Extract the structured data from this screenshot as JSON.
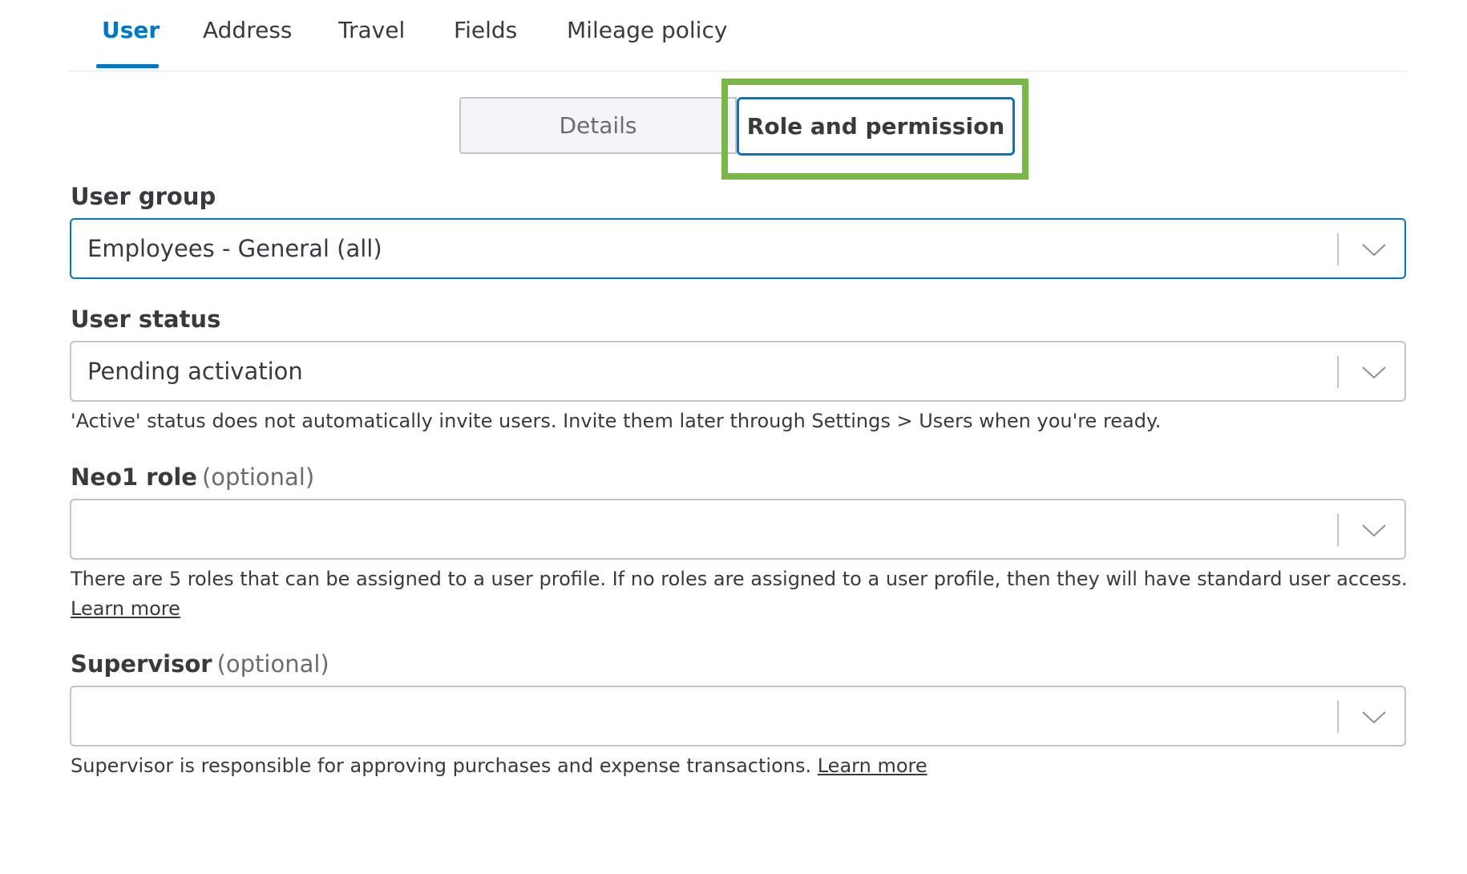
{
  "tabs": [
    {
      "label": "User",
      "active": true
    },
    {
      "label": "Address",
      "active": false
    },
    {
      "label": "Travel",
      "active": false
    },
    {
      "label": "Fields",
      "active": false
    },
    {
      "label": "Mileage policy",
      "active": false
    }
  ],
  "segments": {
    "details_label": "Details",
    "role_label": "Role and permission",
    "selected": "Role and permission"
  },
  "user_group": {
    "label": "User group",
    "value": "Employees - General (all)"
  },
  "user_status": {
    "label": "User status",
    "value": "Pending activation",
    "help": "'Active' status does not automatically invite users. Invite them later through Settings > Users when you're ready."
  },
  "neo1_role": {
    "label": "Neo1 role",
    "optional": "(optional)",
    "value": "",
    "help": "There are 5 roles that can be assigned to a user profile. If no roles are assigned to a user profile, then they will have standard user access.",
    "link": "Learn more"
  },
  "supervisor": {
    "label": "Supervisor",
    "optional": "(optional)",
    "value": "",
    "help": "Supervisor is responsible for approving purchases and expense transactions.",
    "link": "Learn more"
  },
  "colors": {
    "accent": "#0077c5",
    "highlight": "#7ab648"
  }
}
